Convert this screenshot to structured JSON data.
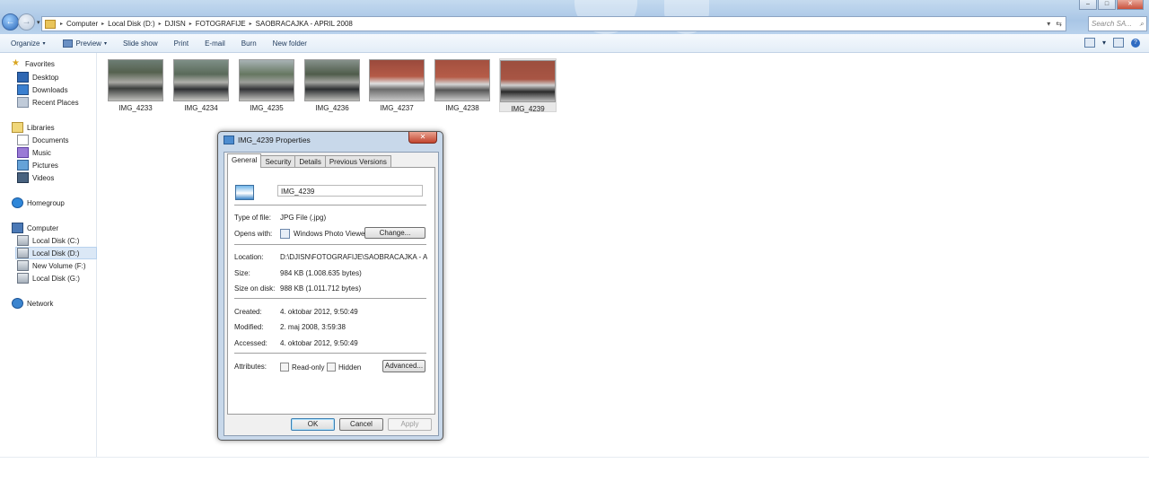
{
  "window": {
    "min_glyph": "–",
    "max_glyph": "□",
    "close_glyph": "✕"
  },
  "nav": {
    "back_glyph": "←",
    "forward_glyph": "→",
    "dropdown_glyph": "▾"
  },
  "address": {
    "crumbs": [
      "Computer",
      "Local Disk (D:)",
      "DJISN",
      "FOTOGRAFIJE",
      "SAOBRACAJKA - APRIL 2008"
    ],
    "separator": "▸",
    "dropdown_glyph": "▾",
    "refresh_glyph": "⇆"
  },
  "search": {
    "placeholder": "Search SA...",
    "icon": "search-icon",
    "glyph": "⌕"
  },
  "toolbar": {
    "organize": "Organize",
    "preview": "Preview",
    "slideshow": "Slide show",
    "print": "Print",
    "email": "E-mail",
    "burn": "Burn",
    "new_folder": "New folder",
    "dropdown_glyph": "▾",
    "help_glyph": "?"
  },
  "sidebar": {
    "favorites": "Favorites",
    "desktop": "Desktop",
    "downloads": "Downloads",
    "recent": "Recent Places",
    "libraries": "Libraries",
    "documents": "Documents",
    "music": "Music",
    "pictures": "Pictures",
    "videos": "Videos",
    "homegroup": "Homegroup",
    "computer": "Computer",
    "disk_c": "Local Disk (C:)",
    "disk_d": "Local Disk (D:)",
    "disk_f": "New Volume (F:)",
    "disk_g": "Local Disk (G:)",
    "network": "Network",
    "star_glyph": "★",
    "selected": "Local Disk (D:)"
  },
  "files": [
    {
      "name": "IMG_4233"
    },
    {
      "name": "IMG_4234"
    },
    {
      "name": "IMG_4235"
    },
    {
      "name": "IMG_4236"
    },
    {
      "name": "IMG_4237"
    },
    {
      "name": "IMG_4238"
    },
    {
      "name": "IMG_4239"
    }
  ],
  "selected_file": "IMG_4239",
  "dialog": {
    "title": "IMG_4239 Properties",
    "close_glyph": "✕",
    "tabs": [
      "General",
      "Security",
      "Details",
      "Previous Versions"
    ],
    "active_tab": "General",
    "file_name": "IMG_4239",
    "type_label": "Type of file:",
    "type_value": "JPG File (.jpg)",
    "opens_label": "Opens with:",
    "opens_value": "Windows Photo Viewer",
    "change_button": "Change...",
    "location_label": "Location:",
    "location_value": "D:\\DJISN\\FOTOGRAFIJE\\SAOBRACAJKA - APRIL",
    "size_label": "Size:",
    "size_value": "984 KB (1.008.635 bytes)",
    "size_disk_label": "Size on disk:",
    "size_disk_value": "988 KB (1.011.712 bytes)",
    "created_label": "Created:",
    "created_value": "4. oktobar 2012, 9:50:49",
    "modified_label": "Modified:",
    "modified_value": "2. maj 2008, 3:59:38",
    "accessed_label": "Accessed:",
    "accessed_value": "4. oktobar 2012, 9:50:49",
    "attributes_label": "Attributes:",
    "readonly_label": "Read-only",
    "hidden_label": "Hidden",
    "advanced_button": "Advanced...",
    "ok_button": "OK",
    "cancel_button": "Cancel",
    "apply_button": "Apply"
  }
}
